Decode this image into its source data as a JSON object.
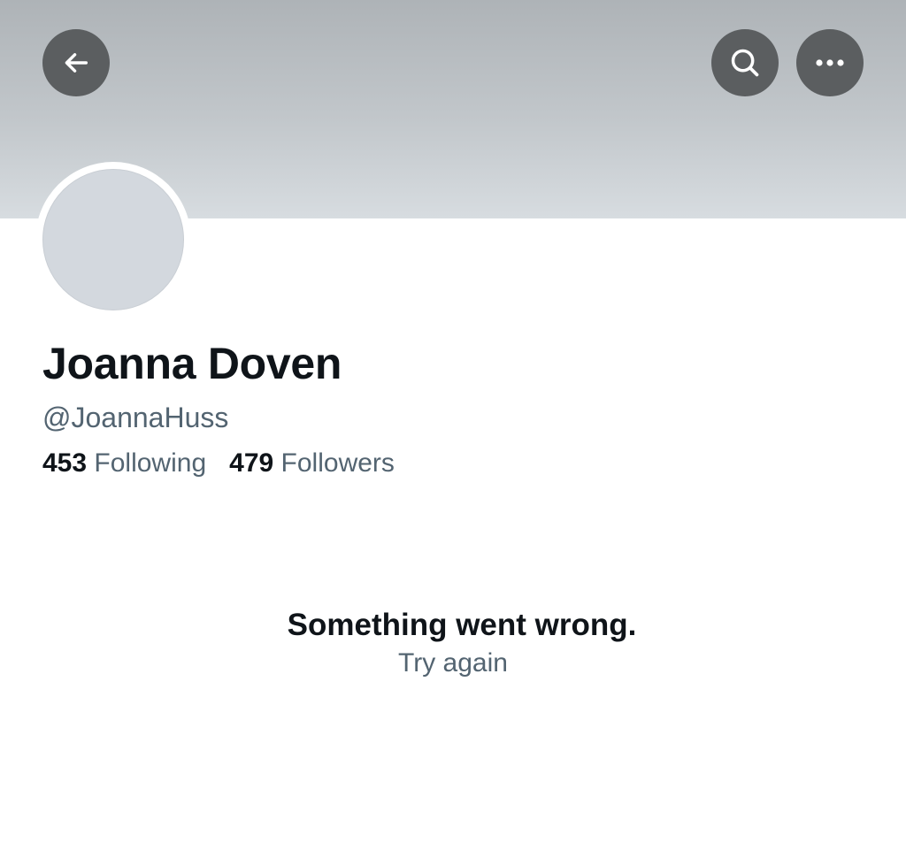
{
  "header": {
    "back_icon": "arrow-left-icon",
    "search_icon": "search-icon",
    "more_icon": "more-horizontal-icon",
    "banner_color": "#b9bec2",
    "button_bg": "#5b5e60"
  },
  "profile": {
    "display_name": "Joanna Doven",
    "handle": "@JoannaHuss",
    "following_count": "453",
    "following_label": "Following",
    "followers_count": "479",
    "followers_label": "Followers",
    "avatar_color": "#d3d8de"
  },
  "error": {
    "title": "Something went wrong.",
    "retry_label": "Try again"
  }
}
